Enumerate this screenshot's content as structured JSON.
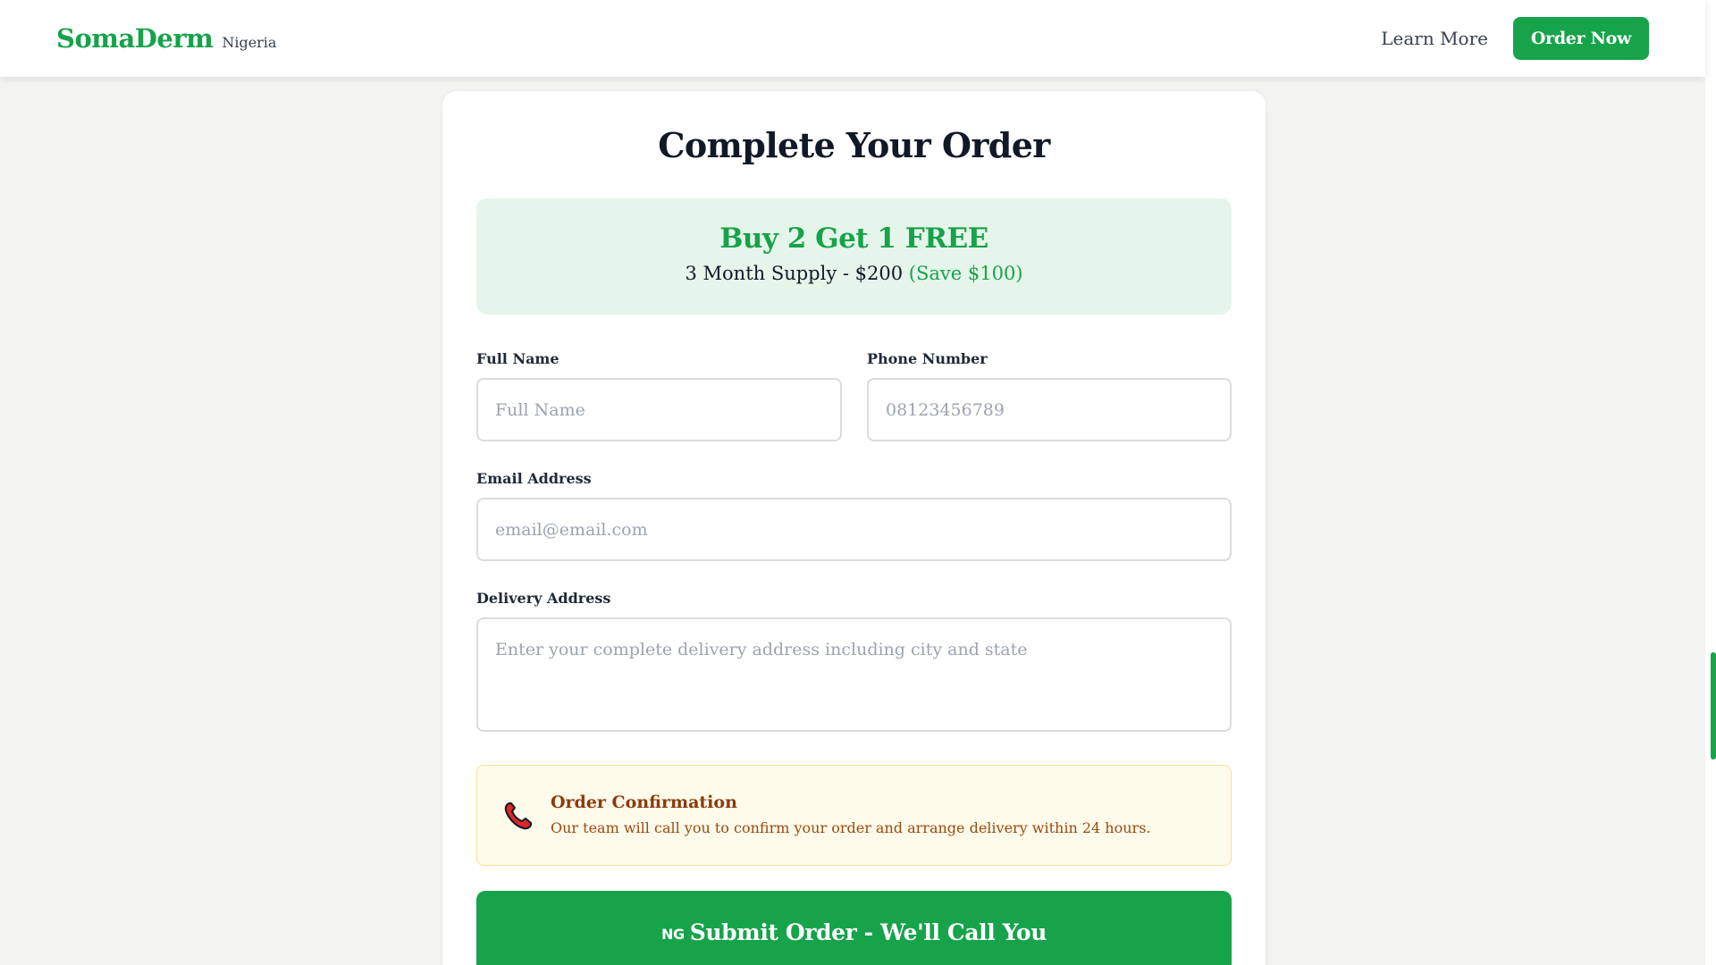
{
  "header": {
    "brand": "SomaDerm",
    "region": "Nigeria",
    "learn_more": "Learn More",
    "order_now": "Order Now"
  },
  "form": {
    "title": "Complete Your Order",
    "offer": {
      "title": "Buy 2 Get 1 FREE",
      "subtitle": "3 Month Supply - $200",
      "save": "(Save $100)"
    },
    "full_name": {
      "label": "Full Name",
      "placeholder": "Full Name",
      "value": ""
    },
    "phone": {
      "label": "Phone Number",
      "placeholder": "08123456789",
      "value": ""
    },
    "email": {
      "label": "Email Address",
      "placeholder": "email@email.com",
      "value": ""
    },
    "address": {
      "label": "Delivery Address",
      "placeholder": "Enter your complete delivery address including city and state",
      "value": ""
    },
    "notice": {
      "icon": "phone-icon",
      "title": "Order Confirmation",
      "text": "Our team will call you to confirm your order and arrange delivery within 24 hours."
    },
    "submit": {
      "flag": "NG",
      "label": "Submit Order - We'll Call You"
    }
  },
  "colors": {
    "brand_green": "#16a34a",
    "offer_bg": "#e6f5ea",
    "notice_bg": "#fefbea",
    "notice_text": "#8b3a0f"
  }
}
